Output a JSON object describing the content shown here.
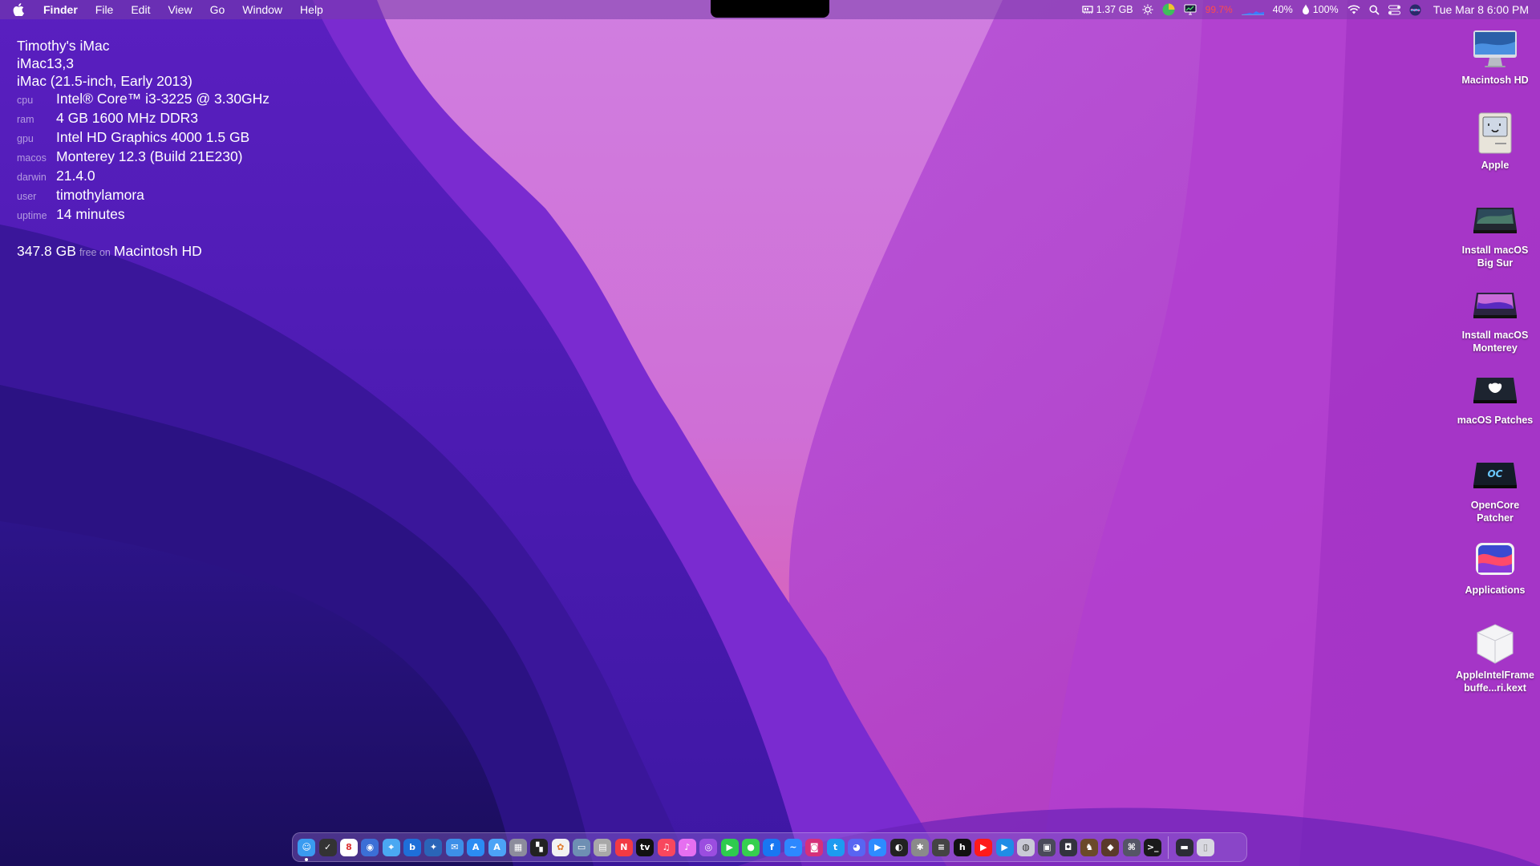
{
  "menubar": {
    "apple_icon": "apple-logo-icon",
    "app_name": "Finder",
    "menus": [
      "File",
      "Edit",
      "View",
      "Go",
      "Window",
      "Help"
    ],
    "status": {
      "memory": "1.37 GB",
      "cpu": "99.7%",
      "cpu_color": "#ff4b4b",
      "battery_level": "40%",
      "fan": "100%",
      "datetime": "Tue Mar 8  6:00 PM"
    }
  },
  "sysinfo": {
    "name": "Timothy's iMac",
    "model_id": "iMac13,3",
    "model": "iMac (21.5-inch, Early 2013)",
    "rows": [
      {
        "key": "cpu",
        "value": "Intel® Core™ i3-3225 @ 3.30GHz"
      },
      {
        "key": "ram",
        "value": "4 GB 1600 MHz DDR3"
      },
      {
        "key": "gpu",
        "value": "Intel HD Graphics 4000 1.5 GB"
      },
      {
        "key": "macos",
        "value": "Monterey 12.3 (Build 21E230)"
      },
      {
        "key": "darwin",
        "value": "21.4.0"
      },
      {
        "key": "user",
        "value": "timothylamora"
      },
      {
        "key": "uptime",
        "value": "14 minutes"
      }
    ],
    "disk_free": "347.8 GB",
    "disk_free_label": "free on",
    "disk_name": "Macintosh HD"
  },
  "desktop": {
    "items": [
      {
        "label": "Macintosh HD",
        "icon": "imac-icon"
      },
      {
        "label": "Apple",
        "icon": "classic-mac-icon"
      },
      {
        "label": "Install macOS Big Sur",
        "icon": "drive-big-sur-icon"
      },
      {
        "label": "Install macOS Monterey",
        "icon": "drive-monterey-icon"
      },
      {
        "label": "macOS Patches",
        "icon": "drive-patches-icon"
      },
      {
        "label": "OpenCore Patcher",
        "icon": "drive-opencore-icon"
      },
      {
        "label": "Applications",
        "icon": "applications-folder-icon"
      },
      {
        "label": "AppleIntelFramebuffe...ri.kext",
        "icon": "kext-bundle-icon"
      }
    ]
  },
  "dock": {
    "apps": [
      {
        "name": "finder-icon",
        "color": "#3a9bf0",
        "glyph": "☺",
        "running": true
      },
      {
        "name": "notes-checklist-icon",
        "color": "#333333",
        "glyph": "✓"
      },
      {
        "name": "calendar-icon",
        "color": "#ffffff",
        "glyph": "8",
        "fg": "#d33"
      },
      {
        "name": "siri-icon",
        "color": "#3b6fd6",
        "glyph": "◉"
      },
      {
        "name": "safari-icon",
        "color": "#4aa8f2",
        "glyph": "⌖"
      },
      {
        "name": "bing-icon",
        "color": "#1e6fd9",
        "glyph": "b"
      },
      {
        "name": "xcode-icon",
        "color": "#2a65b8",
        "glyph": "✦"
      },
      {
        "name": "mail-icon",
        "color": "#3d8fe8",
        "glyph": "✉"
      },
      {
        "name": "app-store-icon",
        "color": "#2b8cf3",
        "glyph": "A"
      },
      {
        "name": "app-store-alt-icon",
        "color": "#4ca3f6",
        "glyph": "A"
      },
      {
        "name": "launchpad-icon",
        "color": "#8c8c9c",
        "glyph": "▦"
      },
      {
        "name": "widgets-icon",
        "color": "#222222",
        "glyph": "▚"
      },
      {
        "name": "photos-icon",
        "color": "#f2f2f2",
        "glyph": "✿",
        "fg": "#e07a2b"
      },
      {
        "name": "preview-icon",
        "color": "#6e8fb3",
        "glyph": "▭"
      },
      {
        "name": "image-capture-icon",
        "color": "#a8a8a8",
        "glyph": "▤"
      },
      {
        "name": "news-icon",
        "color": "#f23a44",
        "glyph": "N"
      },
      {
        "name": "apple-tv-icon",
        "color": "#111111",
        "glyph": "tv"
      },
      {
        "name": "music-icon",
        "color": "#f8475e",
        "glyph": "♫"
      },
      {
        "name": "itunes-icon",
        "color": "#e66ff0",
        "glyph": "♪"
      },
      {
        "name": "podcasts-icon",
        "color": "#9b4de0",
        "glyph": "◎"
      },
      {
        "name": "facetime-icon",
        "color": "#2ecc4e",
        "glyph": "▶"
      },
      {
        "name": "messages-icon",
        "color": "#36d04f",
        "glyph": "●"
      },
      {
        "name": "facebook-icon",
        "color": "#1877f2",
        "glyph": "f"
      },
      {
        "name": "messenger-icon",
        "color": "#2d88ff",
        "glyph": "~"
      },
      {
        "name": "instagram-icon",
        "color": "#d6307a",
        "glyph": "◙"
      },
      {
        "name": "twitter-icon",
        "color": "#1d9bf0",
        "glyph": "t"
      },
      {
        "name": "discord-icon",
        "color": "#5865f2",
        "glyph": "◕"
      },
      {
        "name": "zoom-icon",
        "color": "#2d8cff",
        "glyph": "▶"
      },
      {
        "name": "github-icon",
        "color": "#222222",
        "glyph": "◐"
      },
      {
        "name": "system-preferences-icon",
        "color": "#8a8a8a",
        "glyph": "✱"
      },
      {
        "name": "activity-monitor-icon",
        "color": "#444444",
        "glyph": "≡"
      },
      {
        "name": "hulu-icon",
        "color": "#111111",
        "glyph": "h"
      },
      {
        "name": "youtube-icon",
        "color": "#ff1a1a",
        "glyph": "▶"
      },
      {
        "name": "prime-video-icon",
        "color": "#1f8ce6",
        "glyph": "▶"
      },
      {
        "name": "disk-utility-icon",
        "color": "#c9c9d6",
        "glyph": "◍",
        "fg": "#333"
      },
      {
        "name": "monitor-utility-icon",
        "color": "#4a4a5a",
        "glyph": "▣"
      },
      {
        "name": "screen-capture-icon",
        "color": "#33333d",
        "glyph": "◘"
      },
      {
        "name": "chess-icon",
        "color": "#6b4a2a",
        "glyph": "♞"
      },
      {
        "name": "opencore-patcher-icon",
        "color": "#5a3a2a",
        "glyph": "◆"
      },
      {
        "name": "safari-technology-preview-icon",
        "color": "#555566",
        "glyph": "⌘"
      },
      {
        "name": "terminal-icon",
        "color": "#1a1a1a",
        "glyph": ">_"
      }
    ],
    "extras": [
      {
        "name": "downloads-stack-icon",
        "color": "#2c2c36",
        "glyph": "▬"
      },
      {
        "name": "trash-icon",
        "color": "#d8d8e0",
        "glyph": "▯",
        "fg": "#888"
      }
    ]
  }
}
